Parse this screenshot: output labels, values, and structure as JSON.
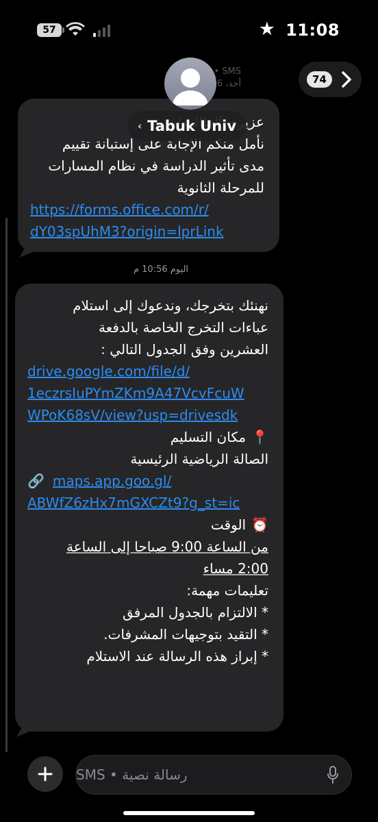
{
  "status": {
    "battery_level": "57",
    "time": "11:08",
    "star_icon": "star-icon"
  },
  "header": {
    "faint_line1": "رسالة نصية • SMS",
    "faint_line2": "أحد، 6 م",
    "contact_name": "Tabuk Univ",
    "back_chevron": "‹",
    "unread_count": "74"
  },
  "messages": [
    {
      "lines": [
        "عزيزي الطالب/ة",
        "نأمل منكم الإجابة على إستبانة تقييم",
        "مدى تأثير الدراسة في نظام المسارات",
        "للمرحلة الثانوية"
      ],
      "link_lines": [
        "https://forms.office.com/r/",
        "dY03spUhM3?origin=lprLink"
      ]
    }
  ],
  "timestamp": "اليوم 10:56 م",
  "message2": {
    "intro": [
      "نهنئك بتخرجك، وندعوك إلى استلام",
      "عباءات التخرج الخاصة بالدفعة",
      "العشرين وفق الجدول التالي :"
    ],
    "drive_link": [
      "drive.google.com/file/d/",
      "1eczrsIuPYmZKm9A47VcvFcuW",
      "WPoK68sV/view?usp=drivesdk"
    ],
    "location_label": "مكان التسليم",
    "location_icon": "📍",
    "location_value": "الصالة الرياضية الرئيسية",
    "link_icon": "🔗",
    "maps_link": [
      "maps.app.goo.gl/",
      "ABWfZ6zHx7mGXCZt9?g_st=ic"
    ],
    "time_icon": "⏰",
    "time_label": "الوقت",
    "time_line1": "من الساعة 9:00 صباحا إلى الساعة",
    "time_line2": "2:00 مساء",
    "instructions_title": "تعليمات مهمة:",
    "instructions": [
      "* الالتزام بالجدول المرفق",
      "* التقيد بتوجيهات المشرفات.",
      "* إبراز هذه الرسالة عند الاستلام"
    ]
  },
  "compose": {
    "placeholder": "رسالة نصية • SMS",
    "plus": "+"
  }
}
